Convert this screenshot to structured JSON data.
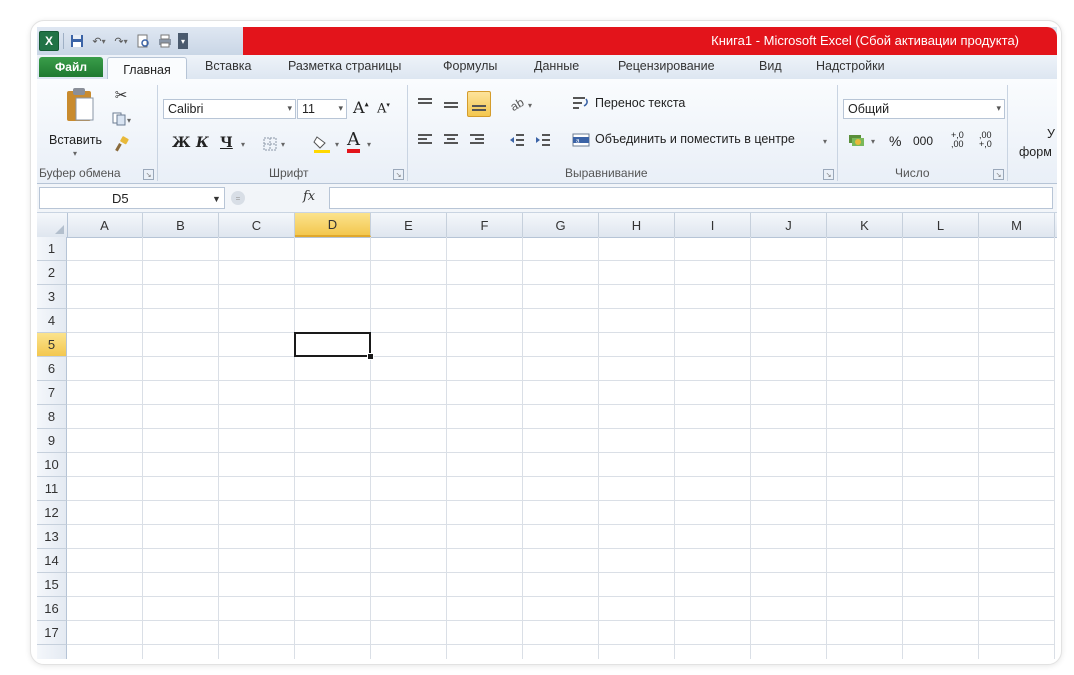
{
  "title": "Книга1  -  Microsoft Excel (Сбой активации продукта)",
  "ribbon_tabs": {
    "file": "Файл",
    "home": "Главная",
    "insert": "Вставка",
    "page_layout": "Разметка страницы",
    "formulas": "Формулы",
    "data": "Данные",
    "review": "Рецензирование",
    "view": "Вид",
    "addins": "Надстройки"
  },
  "clipboard": {
    "paste_label": "Вставить",
    "group_label": "Буфер обмена"
  },
  "font": {
    "name": "Calibri",
    "size": "11",
    "grow_label": "A",
    "shrink_label": "A",
    "bold": "Ж",
    "italic": "К",
    "underline": "Ч",
    "font_color_label": "A",
    "group_label": "Шрифт"
  },
  "alignment": {
    "wrap_text": "Перенос текста",
    "merge_center": "Объединить и поместить в центре",
    "group_label": "Выравнивание"
  },
  "number": {
    "format": "Общий",
    "percent": "%",
    "thousands": "000",
    "inc_decimal": "+,0 ,00",
    "dec_decimal": ",00 +,0",
    "group_label": "Число"
  },
  "styles": {
    "partial_label_top": "У",
    "partial_label_bottom": "форм"
  },
  "formula_bar": {
    "name_box": "D5",
    "fx_label": "fx",
    "value": ""
  },
  "sheet": {
    "columns": [
      "A",
      "B",
      "C",
      "D",
      "E",
      "F",
      "G",
      "H",
      "I",
      "J",
      "K",
      "L",
      "M"
    ],
    "rows": [
      "1",
      "2",
      "3",
      "4",
      "5",
      "6",
      "7",
      "8",
      "9",
      "10",
      "11",
      "12",
      "13",
      "14",
      "15",
      "16",
      "17"
    ],
    "active_column": "D",
    "active_row": "5"
  },
  "colors": {
    "title_bar_red": "#e3141b",
    "file_tab_green": "#1f7a30",
    "active_header": "#f3c74f"
  }
}
